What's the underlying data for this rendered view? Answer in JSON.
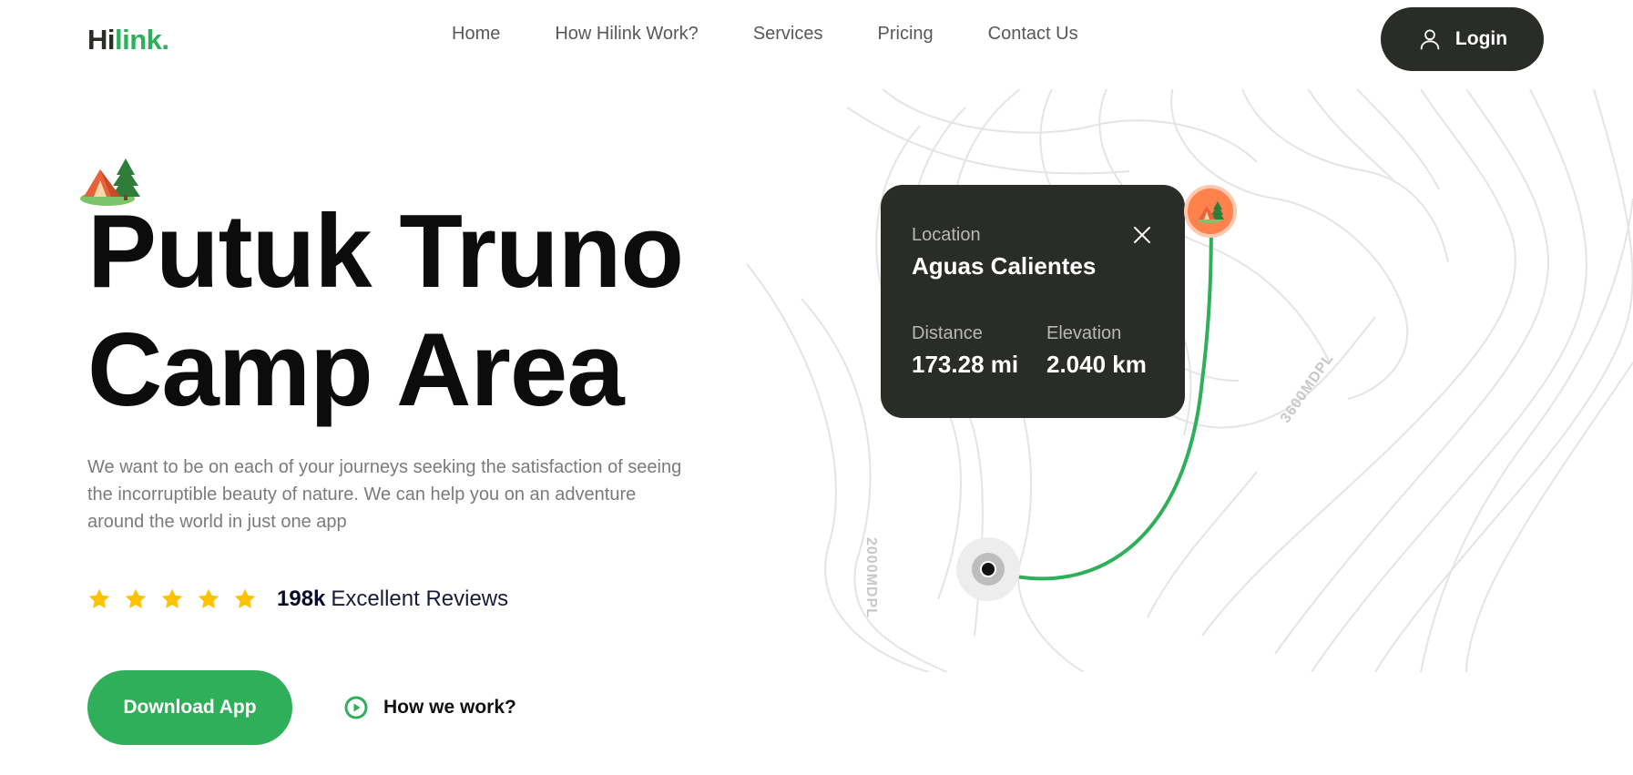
{
  "header": {
    "logo_part1": "Hi",
    "logo_part2": "link.",
    "nav": [
      "Home",
      "How Hilink Work?",
      "Services",
      "Pricing",
      "Contact Us"
    ],
    "login_label": "Login"
  },
  "hero": {
    "title_line1": "Putuk Truno",
    "title_line2": "Camp Area",
    "description": "We want to be on each of your journeys seeking the satisfaction of seeing the incorruptible beauty of nature. We can help you on an adventure around the world in just one app",
    "rating_stars": 5,
    "reviews_count": "198k",
    "reviews_text": "Excellent Reviews",
    "download_label": "Download App",
    "how_label": "How we work?"
  },
  "map": {
    "card": {
      "location_label": "Location",
      "location_value": "Aguas Calientes",
      "distance_label": "Distance",
      "distance_value": "173.28 mi",
      "elevation_label": "Elevation",
      "elevation_value": "2.040 km"
    },
    "contour_label_left": "2000MDPL",
    "contour_label_right": "3600MDPL"
  },
  "colors": {
    "accent_green": "#30af5b",
    "dark": "#292c27",
    "pin_orange": "#ff814c",
    "star_yellow": "#ffc200"
  },
  "icons": {
    "login": "user-icon",
    "close": "close-icon",
    "play": "play-icon",
    "camp": "camping-tent-icon",
    "star": "star-icon"
  }
}
